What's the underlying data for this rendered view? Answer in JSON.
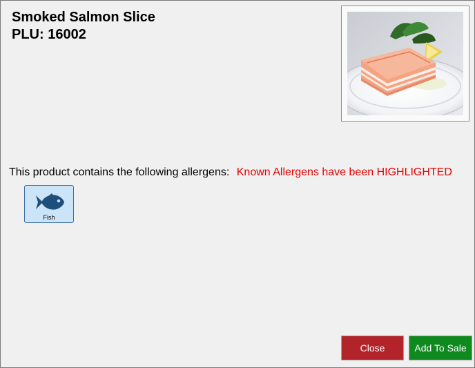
{
  "product": {
    "name": "Smoked Salmon Slice",
    "plu_line": "PLU: 16002"
  },
  "allergens": {
    "intro": "This product contains the following allergens:",
    "highlight_notice": "Known Allergens have been HIGHLIGHTED",
    "items": [
      {
        "label": "Fish",
        "icon": "fish-icon",
        "highlighted": true
      }
    ]
  },
  "buttons": {
    "close_label": "Close",
    "add_label": "Add To Sale"
  },
  "colors": {
    "highlight_text": "#e60000",
    "allergen_tile_bg": "#cce4f7",
    "allergen_tile_border": "#3c6fa8",
    "close_button": "#b3232a",
    "add_button": "#0f8a1f"
  }
}
